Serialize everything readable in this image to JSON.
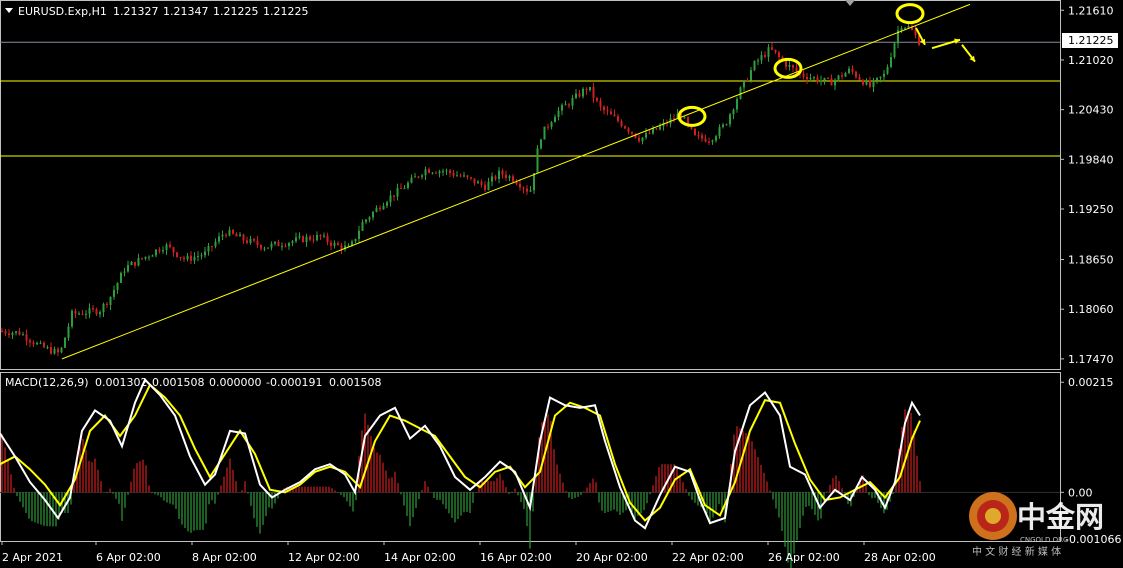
{
  "colors": {
    "background": "#000000",
    "text": "#ffffff",
    "bull_candle": "#2e9e3a",
    "bear_candle": "#d11f1f",
    "trendline": "#ffff00",
    "macd_line": "#ffffff",
    "signal_line": "#ffff00",
    "hist_positive": "#d11f1f",
    "hist_negative": "#2e9e3a",
    "annotation": "#ffff00",
    "frame": "#c0c0c0"
  },
  "chart_data": [
    {
      "type": "candlestick",
      "title": "EURUSD.Exp,H1",
      "ohlc_header": [
        "1.21327",
        "1.21347",
        "1.21225",
        "1.21225"
      ],
      "last_price": "1.21225",
      "y_ticks": [
        "1.21610",
        "1.21020",
        "1.20430",
        "1.19840",
        "1.19250",
        "1.18650",
        "1.18060",
        "1.17470"
      ],
      "y_tick_values": [
        1.2161,
        1.2102,
        1.2043,
        1.1984,
        1.1925,
        1.1865,
        1.1806,
        1.1747
      ],
      "ylim": [
        1.1735,
        1.2172
      ],
      "x_ticks": [
        "2 Apr 2021",
        "6 Apr 02:00",
        "8 Apr 02:00",
        "12 Apr 02:00",
        "14 Apr 02:00",
        "16 Apr 02:00",
        "20 Apr 02:00",
        "22 Apr 02:00",
        "26 Apr 02:00",
        "28 Apr 02:00"
      ],
      "price_path": [
        [
          0,
          1.178
        ],
        [
          20,
          1.1778
        ],
        [
          40,
          1.1762
        ],
        [
          60,
          1.1753
        ],
        [
          72,
          1.18
        ],
        [
          100,
          1.1805
        ],
        [
          110,
          1.182
        ],
        [
          125,
          1.1855
        ],
        [
          145,
          1.1868
        ],
        [
          165,
          1.1882
        ],
        [
          185,
          1.1865
        ],
        [
          205,
          1.1872
        ],
        [
          225,
          1.1898
        ],
        [
          245,
          1.1888
        ],
        [
          265,
          1.188
        ],
        [
          285,
          1.1885
        ],
        [
          305,
          1.189
        ],
        [
          320,
          1.1892
        ],
        [
          335,
          1.1882
        ],
        [
          350,
          1.1878
        ],
        [
          362,
          1.1908
        ],
        [
          385,
          1.1935
        ],
        [
          405,
          1.1952
        ],
        [
          425,
          1.1972
        ],
        [
          445,
          1.197
        ],
        [
          465,
          1.1962
        ],
        [
          485,
          1.1952
        ],
        [
          500,
          1.1968
        ],
        [
          515,
          1.196
        ],
        [
          530,
          1.1945
        ],
        [
          540,
          1.201
        ],
        [
          555,
          1.2038
        ],
        [
          570,
          1.2052
        ],
        [
          588,
          1.207
        ],
        [
          600,
          1.2045
        ],
        [
          620,
          1.2028
        ],
        [
          640,
          1.2008
        ],
        [
          660,
          1.2022
        ],
        [
          680,
          1.2038
        ],
        [
          695,
          1.201
        ],
        [
          710,
          1.2008
        ],
        [
          725,
          1.2025
        ],
        [
          740,
          1.2065
        ],
        [
          755,
          1.2098
        ],
        [
          770,
          1.2115
        ],
        [
          785,
          1.2098
        ],
        [
          800,
          1.2085
        ],
        [
          815,
          1.208
        ],
        [
          830,
          1.2075
        ],
        [
          850,
          1.209
        ],
        [
          870,
          1.207
        ],
        [
          885,
          1.2085
        ],
        [
          900,
          1.2145
        ],
        [
          910,
          1.214
        ],
        [
          920,
          1.2122
        ]
      ],
      "horizontal_levels": [
        1.2123,
        1.2077,
        1.1988
      ],
      "trendline": {
        "from": [
          62,
          1.1747
        ],
        "to": [
          970,
          1.2168
        ]
      },
      "annotations": [
        {
          "type": "ellipse",
          "x": 692,
          "price": 1.2035
        },
        {
          "type": "ellipse",
          "x": 788,
          "price": 1.2092
        },
        {
          "type": "ellipse",
          "x": 910,
          "price": 1.2157
        },
        {
          "type": "arrow",
          "from": [
            916,
            1.214
          ],
          "to": [
            925,
            1.212
          ]
        },
        {
          "type": "arrow",
          "from": [
            932,
            1.2116
          ],
          "to": [
            960,
            1.2126
          ]
        },
        {
          "type": "arrow",
          "from": [
            962,
            1.212
          ],
          "to": [
            975,
            1.21
          ]
        }
      ]
    },
    {
      "type": "line",
      "title": "MACD(12,26,9)",
      "header_values": [
        "0.001302",
        "0.001508",
        "0.000000",
        "-0.000191",
        "0.001508"
      ],
      "y_ticks": [
        "0.00215",
        "0.00"
      ],
      "y_tick_values": [
        0.00215,
        0.0
      ],
      "ylim": [
        -0.00095,
        0.00235
      ],
      "bottom_label": "-0.001066",
      "macd_path": [
        [
          0,
          0.00115
        ],
        [
          15,
          0.0007
        ],
        [
          30,
          0.0002
        ],
        [
          45,
          -0.00015
        ],
        [
          58,
          -0.0005
        ],
        [
          70,
          -0.0001
        ],
        [
          82,
          0.0012
        ],
        [
          95,
          0.0016
        ],
        [
          110,
          0.0014
        ],
        [
          122,
          0.0009
        ],
        [
          135,
          0.00175
        ],
        [
          145,
          0.0022
        ],
        [
          160,
          0.0019
        ],
        [
          175,
          0.0015
        ],
        [
          190,
          0.0007
        ],
        [
          205,
          0.00015
        ],
        [
          215,
          0.00035
        ],
        [
          230,
          0.0012
        ],
        [
          245,
          0.00115
        ],
        [
          260,
          0.00015
        ],
        [
          272,
          -0.0001
        ],
        [
          285,
          5e-05
        ],
        [
          300,
          0.0002
        ],
        [
          315,
          0.00045
        ],
        [
          330,
          0.00055
        ],
        [
          345,
          0.00035
        ],
        [
          355,
          0.0
        ],
        [
          365,
          0.0011
        ],
        [
          380,
          0.0015
        ],
        [
          395,
          0.00165
        ],
        [
          410,
          0.00105
        ],
        [
          425,
          0.0013
        ],
        [
          440,
          0.0009
        ],
        [
          455,
          0.0003
        ],
        [
          470,
          5e-05
        ],
        [
          485,
          0.0003
        ],
        [
          500,
          0.0006
        ],
        [
          515,
          0.0004
        ],
        [
          530,
          -0.0003
        ],
        [
          540,
          0.001
        ],
        [
          550,
          0.00185
        ],
        [
          565,
          0.0017
        ],
        [
          580,
          0.00165
        ],
        [
          595,
          0.0017
        ],
        [
          605,
          0.001
        ],
        [
          620,
          0.0001
        ],
        [
          635,
          -0.00055
        ],
        [
          645,
          -0.0007
        ],
        [
          660,
          -5e-05
        ],
        [
          675,
          0.0005
        ],
        [
          690,
          0.0004
        ],
        [
          700,
          -0.00015
        ],
        [
          710,
          -0.0006
        ],
        [
          725,
          -0.0005
        ],
        [
          735,
          0.0008
        ],
        [
          750,
          0.0017
        ],
        [
          765,
          0.00195
        ],
        [
          780,
          0.0015
        ],
        [
          790,
          0.0005
        ],
        [
          805,
          0.00035
        ],
        [
          820,
          -0.0003
        ],
        [
          835,
          5e-05
        ],
        [
          850,
          -0.00015
        ],
        [
          862,
          0.0003
        ],
        [
          875,
          5e-05
        ],
        [
          885,
          -0.0003
        ],
        [
          895,
          0.0002
        ],
        [
          905,
          0.00135
        ],
        [
          912,
          0.00175
        ],
        [
          920,
          0.0015
        ]
      ],
      "signal_path": [
        [
          0,
          0.00055
        ],
        [
          15,
          0.0007
        ],
        [
          30,
          0.00045
        ],
        [
          45,
          0.00015
        ],
        [
          60,
          -0.00025
        ],
        [
          75,
          0.00025
        ],
        [
          90,
          0.0012
        ],
        [
          105,
          0.0015
        ],
        [
          120,
          0.0011
        ],
        [
          135,
          0.0015
        ],
        [
          150,
          0.0021
        ],
        [
          165,
          0.00185
        ],
        [
          180,
          0.0015
        ],
        [
          195,
          0.00085
        ],
        [
          210,
          0.0003
        ],
        [
          225,
          0.00075
        ],
        [
          240,
          0.0012
        ],
        [
          255,
          0.00075
        ],
        [
          270,
          5e-05
        ],
        [
          285,
          0.0
        ],
        [
          300,
          0.00015
        ],
        [
          315,
          0.0004
        ],
        [
          330,
          0.0005
        ],
        [
          345,
          0.0004
        ],
        [
          360,
          0.0001
        ],
        [
          375,
          0.001
        ],
        [
          390,
          0.0015
        ],
        [
          405,
          0.0014
        ],
        [
          420,
          0.00125
        ],
        [
          435,
          0.0011
        ],
        [
          450,
          0.0007
        ],
        [
          465,
          0.0003
        ],
        [
          480,
          0.0001
        ],
        [
          495,
          0.0004
        ],
        [
          510,
          0.0005
        ],
        [
          525,
          0.0001
        ],
        [
          540,
          0.0004
        ],
        [
          555,
          0.0015
        ],
        [
          570,
          0.00175
        ],
        [
          585,
          0.00165
        ],
        [
          600,
          0.0015
        ],
        [
          615,
          0.00055
        ],
        [
          630,
          -0.0002
        ],
        [
          645,
          -0.00055
        ],
        [
          660,
          -0.0003
        ],
        [
          675,
          0.00025
        ],
        [
          690,
          0.00045
        ],
        [
          705,
          -0.00025
        ],
        [
          720,
          -0.00045
        ],
        [
          735,
          0.0002
        ],
        [
          750,
          0.0012
        ],
        [
          765,
          0.0018
        ],
        [
          780,
          0.00175
        ],
        [
          795,
          0.00095
        ],
        [
          810,
          0.00025
        ],
        [
          825,
          -0.00015
        ],
        [
          840,
          -0.0001
        ],
        [
          855,
          5e-05
        ],
        [
          870,
          0.0002
        ],
        [
          885,
          -0.0001
        ],
        [
          900,
          0.0003
        ],
        [
          912,
          0.00105
        ],
        [
          920,
          0.0014
        ]
      ]
    }
  ],
  "watermark": {
    "brand": "中金网",
    "sub": "中 文 财 经 新 媒 体",
    "domain": "CNGOLD.ORG"
  }
}
